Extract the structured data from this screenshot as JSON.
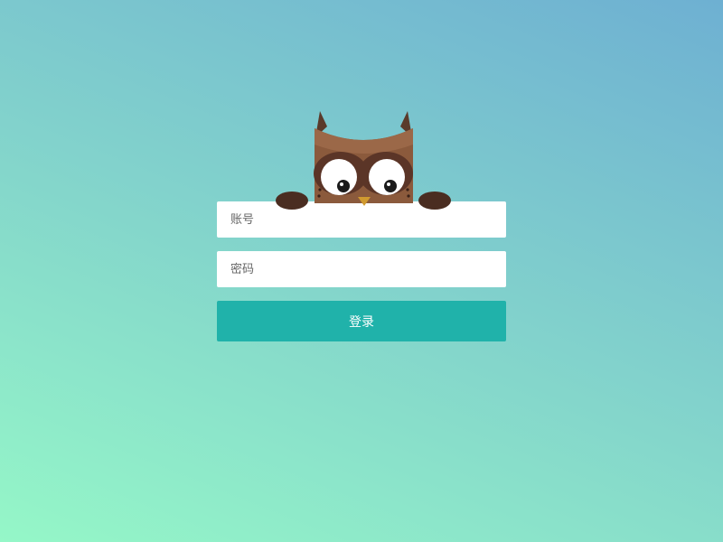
{
  "login": {
    "username_placeholder": "账号",
    "password_placeholder": "密码",
    "submit_label": "登录"
  },
  "colors": {
    "accent": "#20b2aa",
    "background_start": "#95f7c8",
    "background_end": "#6eb0d2",
    "owl_body": "#8b5a3c",
    "owl_hands": "#4a2d21"
  },
  "icons": {
    "mascot": "owl-icon"
  }
}
